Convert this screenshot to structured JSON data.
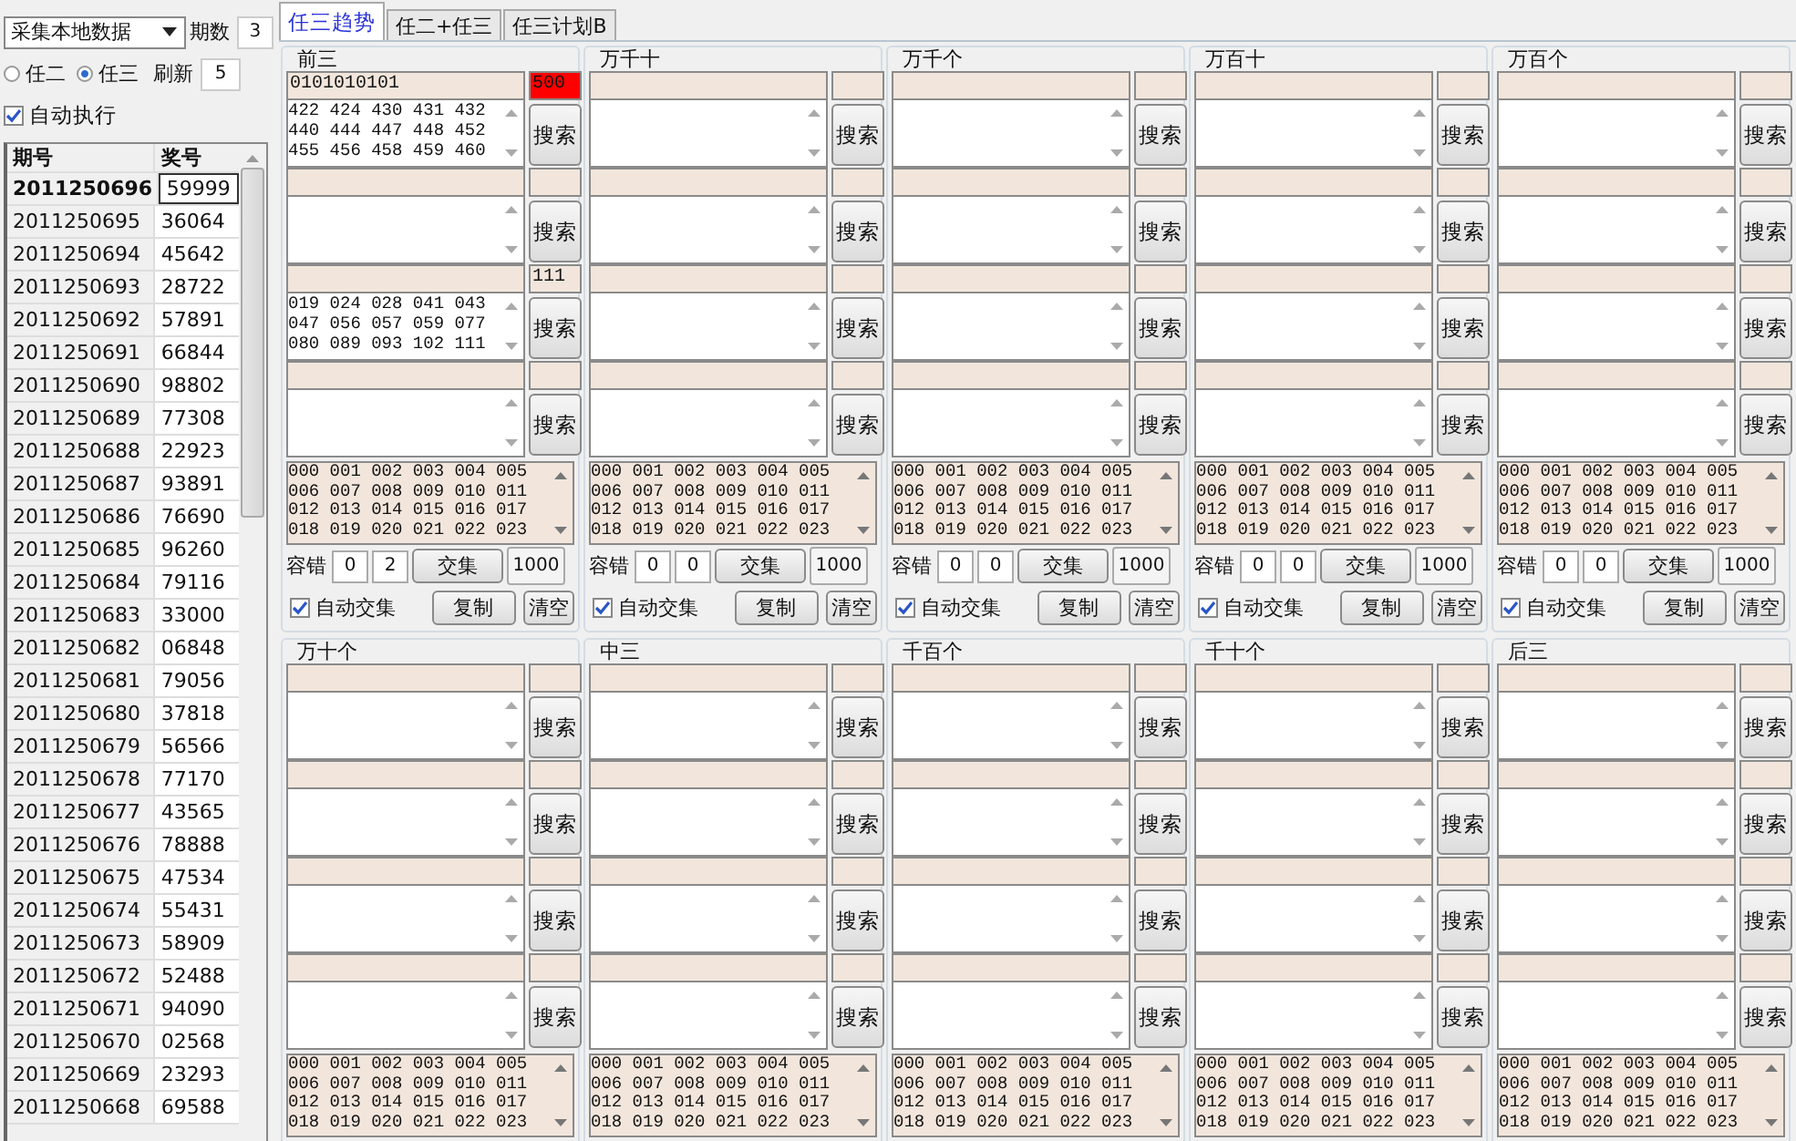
{
  "left_panel": {
    "source_dropdown": "采集本地数据",
    "periods_label": "期数",
    "periods_value": "3",
    "modes": [
      {
        "label": "任二",
        "selected": false
      },
      {
        "label": "任三",
        "selected": true
      }
    ],
    "refresh_label": "刷新",
    "refresh_value": "5",
    "auto_run": {
      "label": "自动执行",
      "checked": true
    },
    "table": {
      "columns": [
        "期号",
        "奖号"
      ],
      "rows": [
        {
          "period": "2011250696",
          "number": "59999",
          "selected": true
        },
        {
          "period": "2011250695",
          "number": "36064",
          "selected": false
        },
        {
          "period": "2011250694",
          "number": "45642",
          "selected": false
        },
        {
          "period": "2011250693",
          "number": "28722",
          "selected": false
        },
        {
          "period": "2011250692",
          "number": "57891",
          "selected": false
        },
        {
          "period": "2011250691",
          "number": "66844",
          "selected": false
        },
        {
          "period": "2011250690",
          "number": "98802",
          "selected": false
        },
        {
          "period": "2011250689",
          "number": "77308",
          "selected": false
        },
        {
          "period": "2011250688",
          "number": "22923",
          "selected": false
        },
        {
          "period": "2011250687",
          "number": "93891",
          "selected": false
        },
        {
          "period": "2011250686",
          "number": "76690",
          "selected": false
        },
        {
          "period": "2011250685",
          "number": "96260",
          "selected": false
        },
        {
          "period": "2011250684",
          "number": "79116",
          "selected": false
        },
        {
          "period": "2011250683",
          "number": "33000",
          "selected": false
        },
        {
          "period": "2011250682",
          "number": "06848",
          "selected": false
        },
        {
          "period": "2011250681",
          "number": "79056",
          "selected": false
        },
        {
          "period": "2011250680",
          "number": "37818",
          "selected": false
        },
        {
          "period": "2011250679",
          "number": "56566",
          "selected": false
        },
        {
          "period": "2011250678",
          "number": "77170",
          "selected": false
        },
        {
          "period": "2011250677",
          "number": "43565",
          "selected": false
        },
        {
          "period": "2011250676",
          "number": "78888",
          "selected": false
        },
        {
          "period": "2011250675",
          "number": "47534",
          "selected": false
        },
        {
          "period": "2011250674",
          "number": "55431",
          "selected": false
        },
        {
          "period": "2011250673",
          "number": "58909",
          "selected": false
        },
        {
          "period": "2011250672",
          "number": "52488",
          "selected": false
        },
        {
          "period": "2011250671",
          "number": "94090",
          "selected": false
        },
        {
          "period": "2011250670",
          "number": "02568",
          "selected": false
        },
        {
          "period": "2011250669",
          "number": "23293",
          "selected": false
        },
        {
          "period": "2011250668",
          "number": "69588",
          "selected": false
        }
      ]
    }
  },
  "tabs": [
    {
      "label": "任三趋势",
      "selected": true
    },
    {
      "label": "任二+任三",
      "selected": false
    },
    {
      "label": "任三计划B",
      "selected": false
    }
  ],
  "groups": [
    {
      "title": "前三",
      "slots": [
        {
          "pattern": "0101010101",
          "count": "500",
          "alert": true,
          "numbers": [
            "422 424 430 431 432",
            "440 444 447 448 452",
            "455 456 458 459 460"
          ],
          "button": "搜索"
        },
        {
          "button": "搜索"
        },
        {
          "count": "111",
          "alert": false,
          "numbers": [
            "019 024 028 041 043",
            "047 056 057 059 077",
            "080 089 093 102 111"
          ],
          "button": "搜索"
        },
        {
          "button": "搜索"
        }
      ],
      "results": [
        "000 001 002 003 004 005",
        "006 007 008 009 010 011",
        "012 013 014 015 016 017",
        "018 019 020 021 022 023"
      ],
      "controls": {
        "tolerance_label": "容错",
        "tolerance": [
          "0",
          "2"
        ],
        "intersect": "交集",
        "limit": "1000",
        "auto_intersect": {
          "label": "自动交集",
          "checked": true
        },
        "copy": "复制",
        "clear": "清空"
      }
    },
    {
      "title": "万千十",
      "slots": [
        {
          "button": "搜索"
        },
        {
          "button": "搜索"
        },
        {
          "button": "搜索"
        },
        {
          "button": "搜索"
        }
      ],
      "results": [
        "000 001 002 003 004 005",
        "006 007 008 009 010 011",
        "012 013 014 015 016 017",
        "018 019 020 021 022 023"
      ],
      "controls": {
        "tolerance_label": "容错",
        "tolerance": [
          "0",
          "0"
        ],
        "intersect": "交集",
        "limit": "1000",
        "auto_intersect": {
          "label": "自动交集",
          "checked": true
        },
        "copy": "复制",
        "clear": "清空"
      }
    },
    {
      "title": "万千个",
      "slots": [
        {
          "button": "搜索"
        },
        {
          "button": "搜索"
        },
        {
          "button": "搜索"
        },
        {
          "button": "搜索"
        }
      ],
      "results": [
        "000 001 002 003 004 005",
        "006 007 008 009 010 011",
        "012 013 014 015 016 017",
        "018 019 020 021 022 023"
      ],
      "controls": {
        "tolerance_label": "容错",
        "tolerance": [
          "0",
          "0"
        ],
        "intersect": "交集",
        "limit": "1000",
        "auto_intersect": {
          "label": "自动交集",
          "checked": true
        },
        "copy": "复制",
        "clear": "清空"
      }
    },
    {
      "title": "万百十",
      "slots": [
        {
          "button": "搜索"
        },
        {
          "button": "搜索"
        },
        {
          "button": "搜索"
        },
        {
          "button": "搜索"
        }
      ],
      "results": [
        "000 001 002 003 004 005",
        "006 007 008 009 010 011",
        "012 013 014 015 016 017",
        "018 019 020 021 022 023"
      ],
      "controls": {
        "tolerance_label": "容错",
        "tolerance": [
          "0",
          "0"
        ],
        "intersect": "交集",
        "limit": "1000",
        "auto_intersect": {
          "label": "自动交集",
          "checked": true
        },
        "copy": "复制",
        "clear": "清空"
      }
    },
    {
      "title": "万百个",
      "slots": [
        {
          "button": "搜索"
        },
        {
          "button": "搜索"
        },
        {
          "button": "搜索"
        },
        {
          "button": "搜索"
        }
      ],
      "results": [
        "000 001 002 003 004 005",
        "006 007 008 009 010 011",
        "012 013 014 015 016 017",
        "018 019 020 021 022 023"
      ],
      "controls": {
        "tolerance_label": "容错",
        "tolerance": [
          "0",
          "0"
        ],
        "intersect": "交集",
        "limit": "1000",
        "auto_intersect": {
          "label": "自动交集",
          "checked": true
        },
        "copy": "复制",
        "clear": "清空"
      }
    },
    {
      "title": "万十个",
      "slots": [
        {
          "button": "搜索"
        },
        {
          "button": "搜索"
        },
        {
          "button": "搜索"
        },
        {
          "button": "搜索"
        }
      ],
      "results": [
        "000 001 002 003 004 005",
        "006 007 008 009 010 011",
        "012 013 014 015 016 017",
        "018 019 020 021 022 023"
      ]
    },
    {
      "title": "中三",
      "slots": [
        {
          "button": "搜索"
        },
        {
          "button": "搜索"
        },
        {
          "button": "搜索"
        },
        {
          "button": "搜索"
        }
      ],
      "results": [
        "000 001 002 003 004 005",
        "006 007 008 009 010 011",
        "012 013 014 015 016 017",
        "018 019 020 021 022 023"
      ]
    },
    {
      "title": "千百个",
      "slots": [
        {
          "button": "搜索"
        },
        {
          "button": "搜索"
        },
        {
          "button": "搜索"
        },
        {
          "button": "搜索"
        }
      ],
      "results": [
        "000 001 002 003 004 005",
        "006 007 008 009 010 011",
        "012 013 014 015 016 017",
        "018 019 020 021 022 023"
      ]
    },
    {
      "title": "千十个",
      "slots": [
        {
          "button": "搜索"
        },
        {
          "button": "搜索"
        },
        {
          "button": "搜索"
        },
        {
          "button": "搜索"
        }
      ],
      "results": [
        "000 001 002 003 004 005",
        "006 007 008 009 010 011",
        "012 013 014 015 016 017",
        "018 019 020 021 022 023"
      ]
    },
    {
      "title": "后三",
      "slots": [
        {
          "button": "搜索"
        },
        {
          "button": "搜索"
        },
        {
          "button": "搜索"
        },
        {
          "button": "搜索"
        }
      ],
      "results": [
        "000 001 002 003 004 005",
        "006 007 008 009 010 011",
        "012 013 014 015 016 017",
        "018 019 020 021 022 023"
      ]
    }
  ]
}
